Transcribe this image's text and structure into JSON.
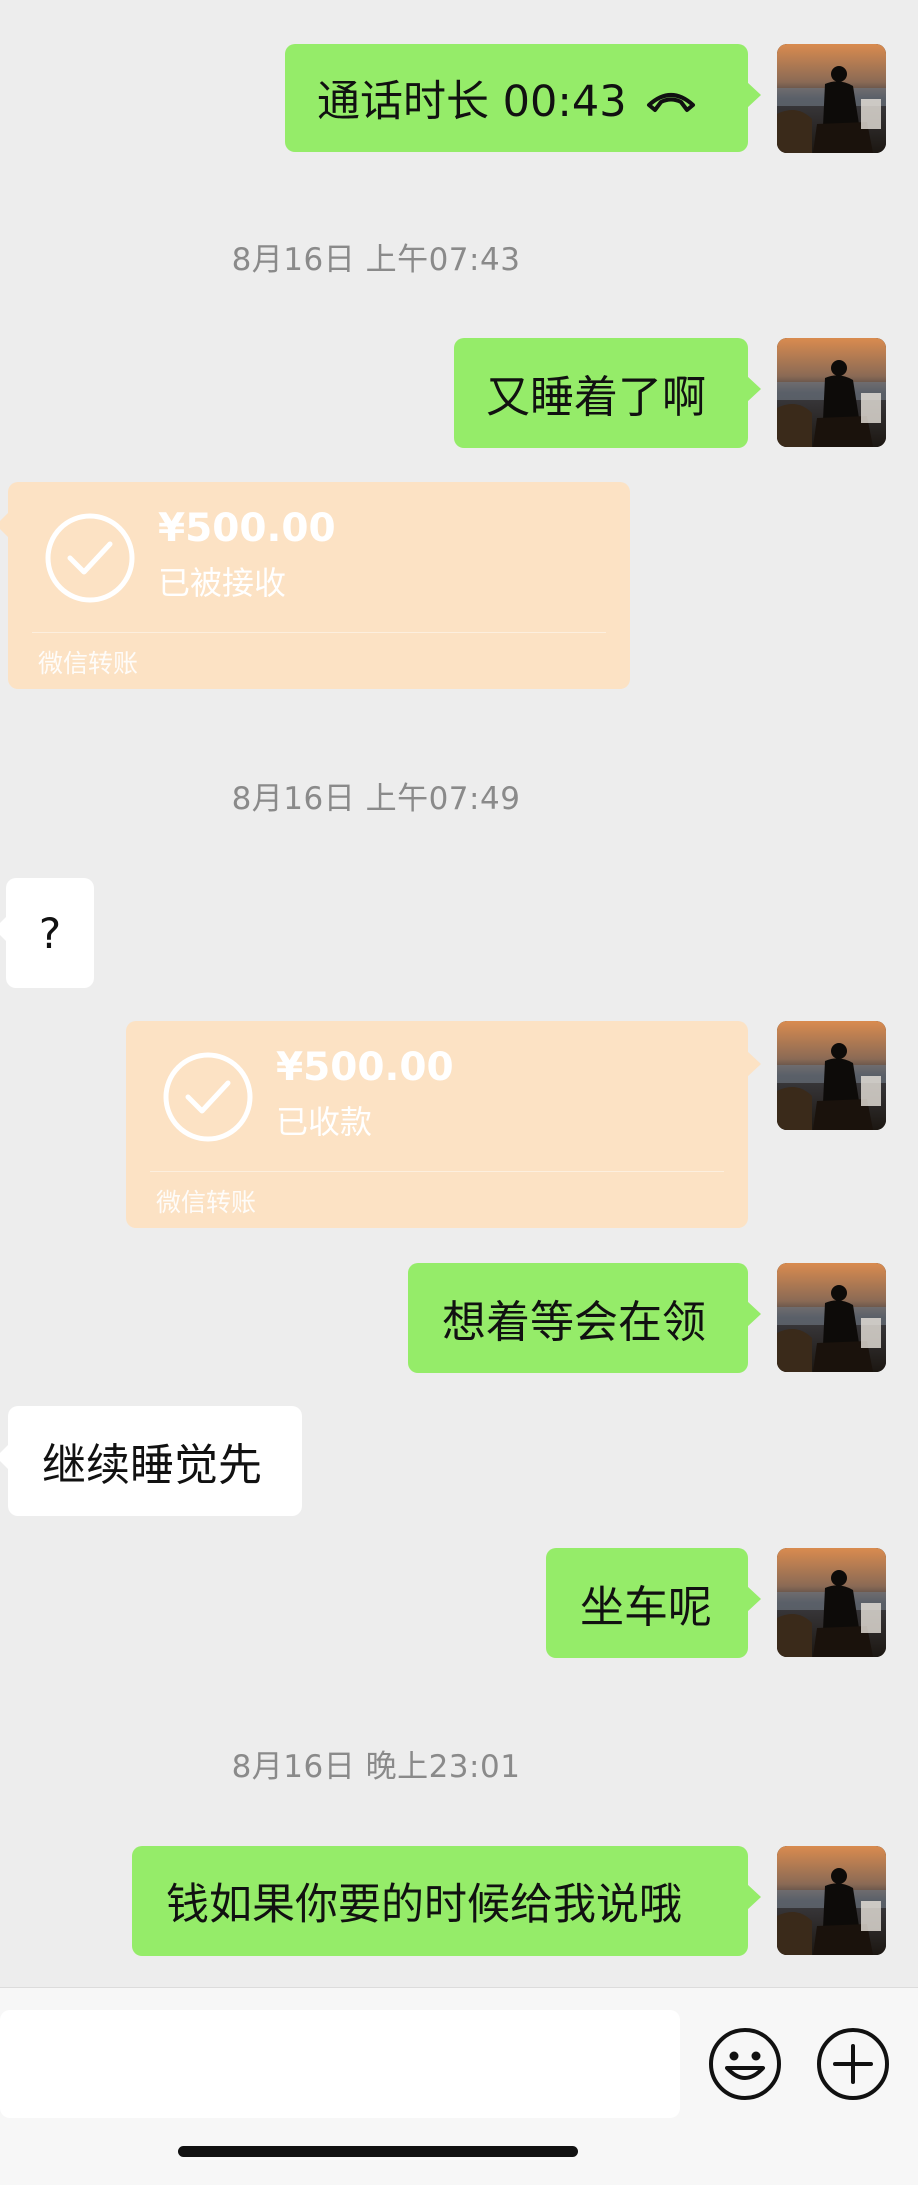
{
  "messages": {
    "call": {
      "text": "通话时长 00:43"
    },
    "ts1": "8月16日 上午07:43",
    "m_sleep_again": "又睡着了啊",
    "transfer1": {
      "amount": "¥500.00",
      "status": "已被接收",
      "footer": "微信转账"
    },
    "ts2": "8月16日 上午07:49",
    "m_question": "?",
    "transfer2": {
      "amount": "¥500.00",
      "status": "已收款",
      "footer": "微信转账"
    },
    "m_later": "想着等会在领",
    "m_keep_sleeping": "继续睡觉先",
    "m_on_bus": "坐车呢",
    "ts3": "8月16日 晚上23:01",
    "m_money": "钱如果你要的时候给我说哦"
  },
  "input_bar": {
    "placeholder": "",
    "emoji_icon": "emoji-icon",
    "plus_icon": "plus-icon"
  },
  "colors": {
    "sent_bubble": "#95ec69",
    "received_bubble": "#ffffff",
    "transfer_card": "#fce2c4",
    "background": "#ededed"
  }
}
